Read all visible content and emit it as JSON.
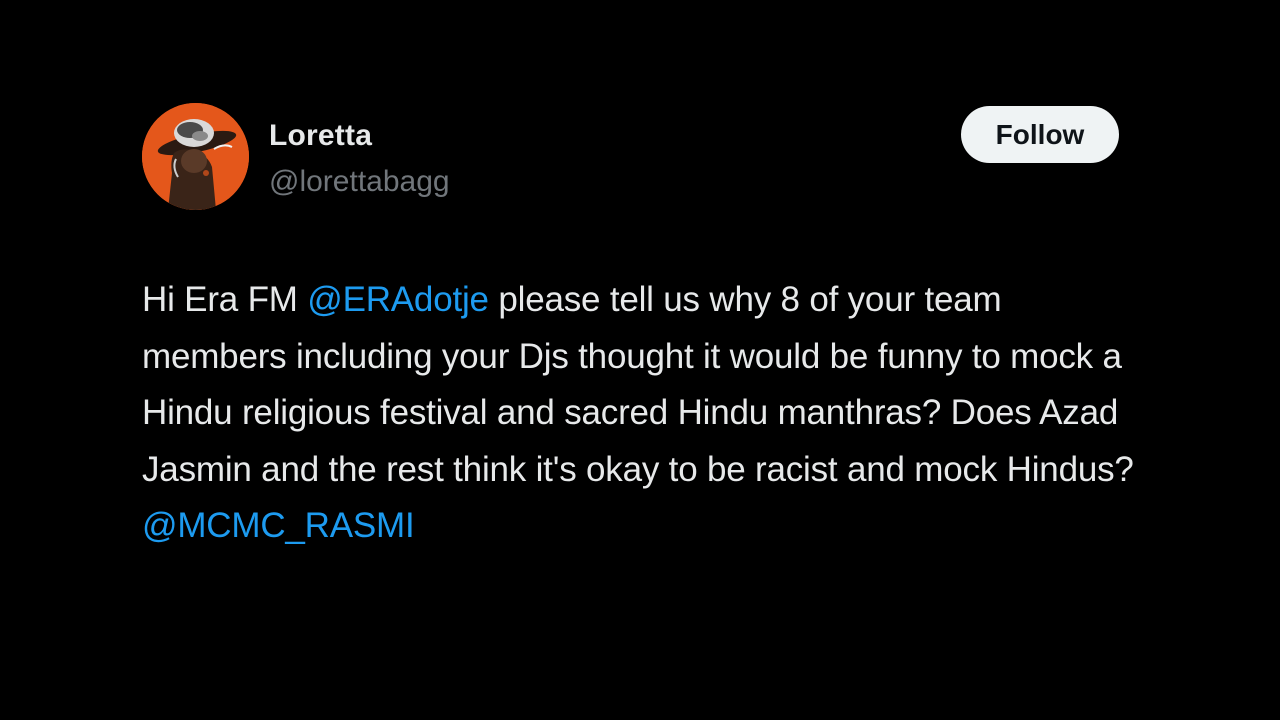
{
  "tweet": {
    "author": {
      "display_name": "Loretta",
      "handle": "@lorettabagg",
      "avatar_icon": "profile-photo",
      "avatar_bg": "#e4571b"
    },
    "follow_label": "Follow",
    "text_parts": {
      "p1": "Hi Era FM ",
      "mention1": "@ERAdotje",
      "p2": " please tell us why 8 of your team members including your Djs thought it would be funny to mock a Hindu religious festival and sacred Hindu manthras? Does Azad Jasmin and the rest think it's okay to be racist and mock Hindus?",
      "mention2": "@MCMC_RASMI"
    }
  },
  "colors": {
    "background": "#000000",
    "text": "#e7e9ea",
    "muted": "#71767b",
    "link": "#1d9bf0",
    "button_bg": "#eff3f4",
    "button_text": "#0f1419"
  }
}
